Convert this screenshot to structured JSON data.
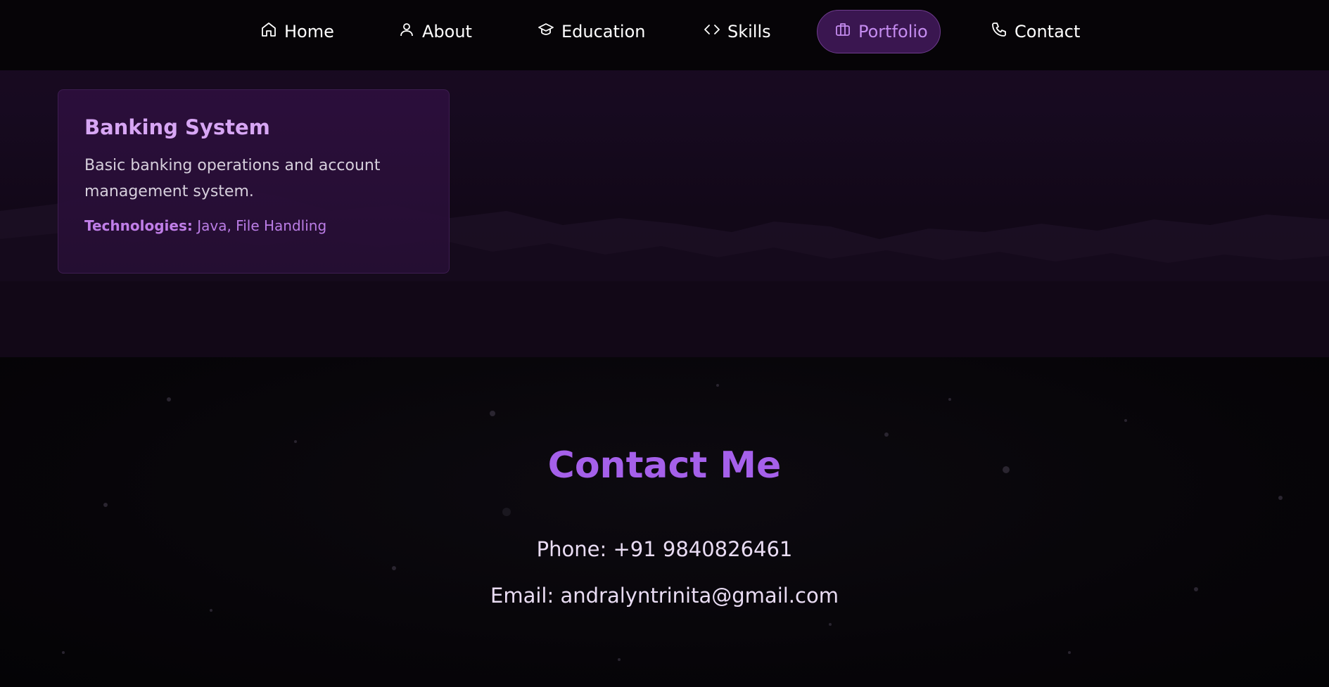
{
  "nav": {
    "items": [
      {
        "label": "Home",
        "icon": "home-icon"
      },
      {
        "label": "About",
        "icon": "user-icon"
      },
      {
        "label": "Education",
        "icon": "graduation-cap-icon"
      },
      {
        "label": "Skills",
        "icon": "code-icon"
      },
      {
        "label": "Portfolio",
        "icon": "briefcase-icon"
      },
      {
        "label": "Contact",
        "icon": "phone-icon"
      }
    ],
    "active": "Portfolio"
  },
  "portfolio": {
    "project": {
      "title": "Banking System",
      "description": "Basic banking operations and account management system.",
      "tech_label": "Technologies:",
      "tech_values": "Java, File Handling"
    }
  },
  "contact": {
    "title": "Contact Me",
    "phone": "Phone: +91 9840826461",
    "email": "Email: andralyntrinita@gmail.com"
  },
  "colors": {
    "accent": "#a560ea",
    "active_nav_bg": "#3a1650",
    "card_title": "#d7a6f4",
    "background": "#050307"
  }
}
